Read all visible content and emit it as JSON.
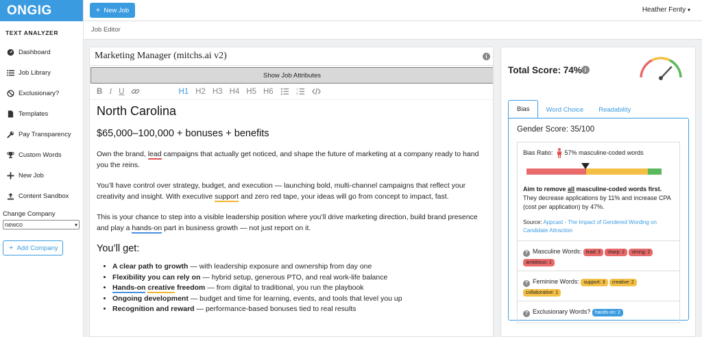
{
  "brand": "ONGIG",
  "sidebar": {
    "title": "TEXT ANALYZER",
    "items": [
      {
        "label": "Dashboard",
        "icon": "dashboard-icon"
      },
      {
        "label": "Job Library",
        "icon": "list-icon"
      },
      {
        "label": "Exclusionary?",
        "icon": "ban-icon"
      },
      {
        "label": "Templates",
        "icon": "file-icon"
      },
      {
        "label": "Pay Transparency",
        "icon": "wrench-icon"
      },
      {
        "label": "Custom Words",
        "icon": "trophy-icon"
      },
      {
        "label": "New Job",
        "icon": "plus-icon"
      },
      {
        "label": "Content Sandbox",
        "icon": "upload-icon"
      }
    ],
    "change_company_label": "Change Company",
    "company_value": "newco",
    "add_company_label": "Add Company"
  },
  "topbar": {
    "new_job_label": "New Job",
    "user_name": "Heather Fenty"
  },
  "breadcrumb": "Job Editor",
  "editor": {
    "job_title": "Marketing Manager (mitchs.ai v2)",
    "show_attributes_label": "Show Job Attributes",
    "toolbar": {
      "bold": "B",
      "italic": "I",
      "underline": "U",
      "h1": "H1",
      "h2": "H2",
      "h3": "H3",
      "h4": "H4",
      "h5": "H5",
      "h6": "H6"
    },
    "heading": "North Carolina",
    "salary": "$65,000–100,000 + bonuses + benefits",
    "p1": {
      "a": "Own the brand, ",
      "lead": "lead",
      "b": " campaigns that actually get noticed, and shape the future of marketing at a company ready to hand you the reins."
    },
    "p2": {
      "a": "You’ll have control over strategy, budget, and execution — launching bold, multi-channel campaigns that reflect your creativity and insight. With executive ",
      "support": "support",
      "b": " and zero red tape, your ideas will go from concept to impact, fast."
    },
    "p3": {
      "a": "This is your chance to step into a visible leadership position where you’ll drive marketing direction, build brand presence and play a ",
      "handson": "hands-on",
      "b": " part in business growth — not just report on it."
    },
    "youll_get": "You’ll get:",
    "bullets": [
      {
        "bold": "A clear path to growth",
        "rest": " — with leadership exposure and ownership from day one"
      },
      {
        "bold": "Flexibility you can rely on",
        "rest": " — hybrid setup, generous PTO, and real work-life balance"
      },
      {
        "bold_a": "Hands-on",
        "bold_b": "creative",
        "bold_c": "freedom",
        "rest": " — from digital to traditional, you run the playbook"
      },
      {
        "bold": "Ongoing development",
        "rest": " — budget and time for learning, events, and tools that level you up"
      },
      {
        "bold": "Recognition and reward",
        "rest": " — performance-based bonuses tied to real results"
      }
    ]
  },
  "score": {
    "total_label": "Total Score: 74%",
    "total_value": 74,
    "tabs": [
      "Bias",
      "Word Choice",
      "Readability"
    ],
    "active_tab": "Bias",
    "gender_score": "Gender Score: 35/100",
    "bias_ratio_label": "Bias Ratio:",
    "bias_ratio_text": "57% masculine-coded words",
    "bias_ratio_value": 57,
    "bar_colors": {
      "masculine": "#e86a6a",
      "neutral": "#f3bf44",
      "feminine": "#5cb85c"
    },
    "aim_pre": "Aim to remove ",
    "aim_all": "all",
    "aim_post": " masculine-coded words first.",
    "aim_detail": "They decrease applications by 11% and increase CPA (cost per application) by 47%.",
    "source_label": "Source: ",
    "source_link": "Appcast - The Impact of Gendered Wording on Candidate Attraction",
    "masculine_label": "Masculine Words:",
    "masculine_words": [
      "lead: 3",
      "sharp: 2",
      "strong: 2",
      "ambitious: 1"
    ],
    "feminine_label": "Feminine Words:",
    "feminine_words": [
      "support: 3",
      "creative: 2",
      "collaborative: 1"
    ],
    "exclusionary_label": "Exclusionary Words?",
    "exclusionary_words": [
      "hands-on: 2"
    ]
  }
}
